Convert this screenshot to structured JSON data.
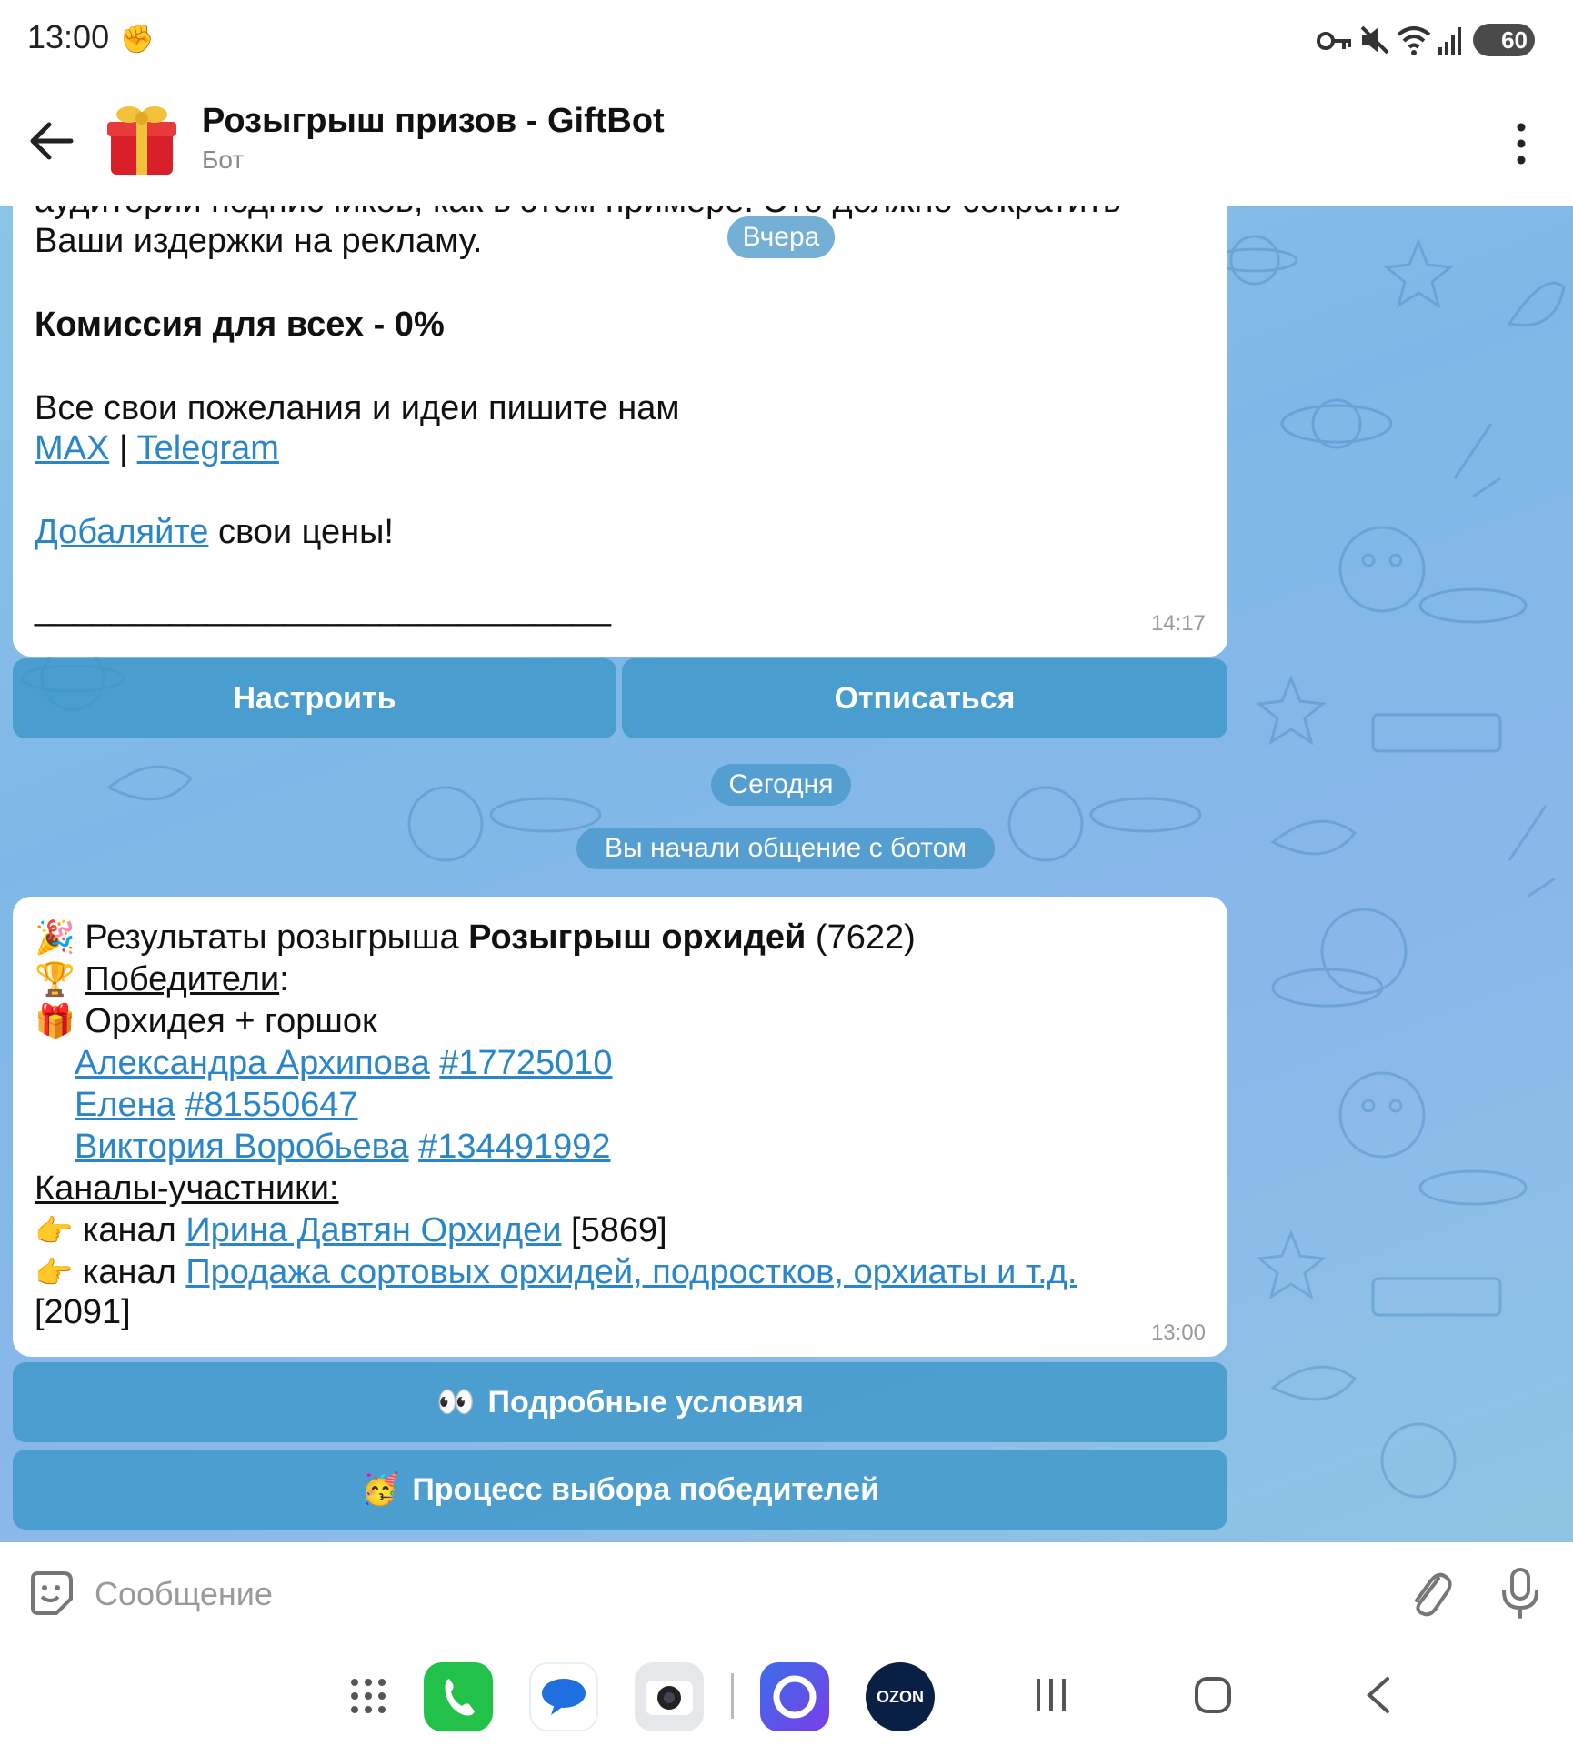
{
  "status_bar": {
    "time": "13:00",
    "battery": "60",
    "icons": [
      "fist-icon",
      "key-icon",
      "mute-icon",
      "wifi-icon",
      "signal-icon",
      "battery-icon"
    ]
  },
  "header": {
    "title": "Розыгрыш призов - GiftBot",
    "subtitle": "Бот"
  },
  "pills": {
    "yesterday": "Вчера",
    "today": "Сегодня",
    "started": "Вы начали общение с ботом"
  },
  "message1": {
    "partial_line": "аудитории подписчиков, как в этом примере. Это должно сократить",
    "line1": "Ваши издержки на рекламу.",
    "commission": "Комиссия для всех - 0%",
    "wishes": "Все свои пожелания и идеи пишите нам",
    "link_max": "MAX",
    "separator": " | ",
    "link_telegram": "Telegram",
    "link_add": "Добаляйте",
    "add_rest": " свои цены!",
    "rule": "______________________________",
    "time": "14:17"
  },
  "keyboard1": {
    "configure": "Настроить",
    "unsubscribe": "Отписаться"
  },
  "message2": {
    "results_prefix": "Результаты розыгрыша ",
    "results_name": "Розыгрыш орхидей",
    "results_id": " (7622)",
    "winners_label": "Победители",
    "winners_colon": ":",
    "prize": "Орхидея + горшок",
    "winners": [
      {
        "name": "Александра Архипова",
        "id": "#17725010"
      },
      {
        "name": "Елена",
        "id": "#81550647"
      },
      {
        "name": "Виктория Воробьева",
        "id": "#134491992"
      }
    ],
    "channels_label": "Каналы-участники:",
    "channels": [
      {
        "prefix": "канал ",
        "name": "Ирина Давтян Орхидеи",
        "count": " [5869]"
      },
      {
        "prefix": "канал ",
        "name": "Продажа сортовых орхидей, подростков, орхиаты и т.д.",
        "count": "[2091]"
      }
    ],
    "time": "13:00"
  },
  "keyboard2": {
    "conditions": "Подробные условия",
    "process": "Процесс выбора победителей"
  },
  "input": {
    "placeholder": "Сообщение"
  },
  "colors": {
    "link": "#2a86c8",
    "button": "#3a96c8",
    "chat_bg": "#8ab9e8"
  }
}
